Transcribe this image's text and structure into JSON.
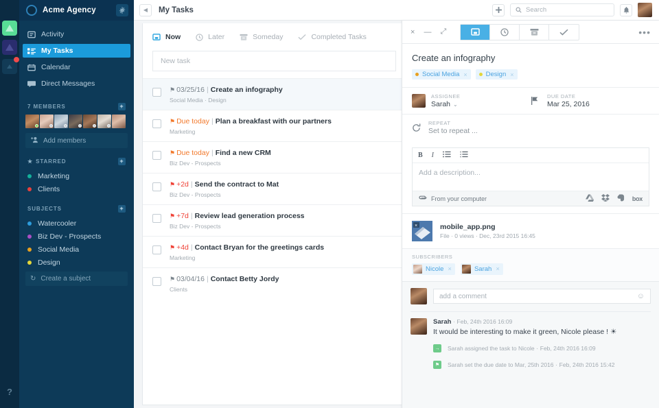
{
  "colors": {
    "sidebar_bg": "#0d3a58",
    "rail_bg": "#0b2b42",
    "accent_blue": "#1b9bdb",
    "tab_active": "#49b0e5",
    "orange": "#f2792c",
    "red": "#ef4136",
    "green": "#6ecb8a"
  },
  "rail": {
    "tiles": [
      {
        "name": "workspace-green",
        "icon": "triangle-icon",
        "badge": false
      },
      {
        "name": "workspace-purple",
        "icon": "triangle-icon",
        "badge": false
      },
      {
        "name": "workspace-muted",
        "icon": "triangle-icon",
        "badge": true
      }
    ],
    "help_label": "?"
  },
  "sidebar": {
    "logo_icon": "circle-logo-icon",
    "workspace_title": "Acme Agency",
    "gear_icon": "gear-icon",
    "nav": [
      {
        "label": "Activity",
        "icon": "activity-icon",
        "active": false
      },
      {
        "label": "My Tasks",
        "icon": "tasks-icon",
        "active": true
      },
      {
        "label": "Calendar",
        "icon": "calendar-icon",
        "active": false
      },
      {
        "label": "Direct Messages",
        "icon": "messages-icon",
        "active": false
      }
    ],
    "members_section": {
      "title": "7 MEMBERS",
      "add_icon": "plus-icon",
      "count": 7,
      "avatars": [
        {
          "name": "member-1",
          "status": "#7ed957"
        },
        {
          "name": "member-2",
          "status": "#c8d0d6"
        },
        {
          "name": "member-3",
          "status": "#c8d0d6"
        },
        {
          "name": "member-4",
          "status": "#c8d0d6"
        },
        {
          "name": "member-5",
          "status": "#c8d0d6"
        },
        {
          "name": "member-6",
          "status": "#c8d0d6"
        },
        {
          "name": "member-7",
          "status": "#c8d0d6"
        }
      ],
      "add_members_label": "Add members",
      "add_members_icon": "add-person-icon"
    },
    "starred_section": {
      "title": "STARRED",
      "star_icon": "star-icon",
      "add_icon": "plus-icon",
      "items": [
        {
          "label": "Marketing",
          "color": "#13b09a"
        },
        {
          "label": "Clients",
          "color": "#e8413c"
        }
      ]
    },
    "subjects_section": {
      "title": "SUBJECTS",
      "add_icon": "plus-icon",
      "items": [
        {
          "label": "Watercooler",
          "color": "#2d9cdb"
        },
        {
          "label": "Biz Dev - Prospects",
          "color": "#a94fc4"
        },
        {
          "label": "Social Media",
          "color": "#e8a020"
        },
        {
          "label": "Design",
          "color": "#e3d63a"
        }
      ],
      "create_label": "Create a subject",
      "create_icon": "refresh-icon"
    }
  },
  "topbar": {
    "collapse_icon": "chevron-left-icon",
    "page_title": "My Tasks",
    "add_icon": "plus-icon",
    "search_icon": "search-icon",
    "search_placeholder": "Search",
    "search_value": "",
    "bell_icon": "bell-icon",
    "avatar_name": "user-avatar"
  },
  "tasklist": {
    "tabs": [
      {
        "label": "Now",
        "icon": "inbox-icon",
        "active": true
      },
      {
        "label": "Later",
        "icon": "clock-icon",
        "active": false
      },
      {
        "label": "Someday",
        "icon": "archive-icon",
        "active": false
      },
      {
        "label": "Completed Tasks",
        "icon": "check-icon",
        "active": false
      }
    ],
    "new_task_placeholder": "New task",
    "new_task_value": "",
    "tasks": [
      {
        "due": "03/25/16",
        "due_style": "gray",
        "name": "Create an infography",
        "subjects": "Social Media · Design",
        "selected": true,
        "checked": false
      },
      {
        "due": "Due today",
        "due_style": "orange",
        "name": "Plan a breakfast with our partners",
        "subjects": "Marketing",
        "selected": false,
        "checked": false
      },
      {
        "due": "Due today",
        "due_style": "orange",
        "name": "Find a new CRM",
        "subjects": "Biz Dev - Prospects",
        "selected": false,
        "checked": false
      },
      {
        "due": "+2d",
        "due_style": "red",
        "name": "Send the contract to Mat",
        "subjects": "Biz Dev - Prospects",
        "selected": false,
        "checked": false
      },
      {
        "due": "+7d",
        "due_style": "red",
        "name": "Review lead generation process",
        "subjects": "Biz Dev - Prospects",
        "selected": false,
        "checked": false
      },
      {
        "due": "+4d",
        "due_style": "red",
        "name": "Contact Bryan for the greetings cards",
        "subjects": "Marketing",
        "selected": false,
        "checked": false
      },
      {
        "due": "03/04/16",
        "due_style": "gray",
        "name": "Contact Betty Jordy",
        "subjects": "Clients",
        "selected": false,
        "checked": false
      }
    ]
  },
  "detail": {
    "window_controls": {
      "close": "×",
      "minimize": "—",
      "expand": "⤢"
    },
    "tabs": [
      {
        "name": "comments-tab",
        "icon": "comment-icon",
        "active": true
      },
      {
        "name": "later-tab",
        "icon": "clock-icon",
        "active": false
      },
      {
        "name": "archive-tab",
        "icon": "archive-icon",
        "active": false
      },
      {
        "name": "complete-tab",
        "icon": "check-icon",
        "active": false
      }
    ],
    "more_icon": "ellipsis-icon",
    "title": "Create an infography",
    "tags": [
      {
        "label": "Social Media",
        "color": "#e8a020",
        "remove": "×"
      },
      {
        "label": "Design",
        "color": "#e3d63a",
        "remove": "×"
      }
    ],
    "assignee": {
      "label": "ASSIGNEE",
      "value": "Sarah",
      "caret": "⌄",
      "avatar": "assignee-avatar"
    },
    "due_date": {
      "label": "DUE DATE",
      "value": "Mar 25, 2016",
      "icon": "flag-icon"
    },
    "repeat": {
      "label": "REPEAT",
      "value": "Set to repeat ...",
      "icon": "repeat-icon"
    },
    "editor": {
      "tools": [
        {
          "name": "bold-icon",
          "glyph": "B"
        },
        {
          "name": "italic-icon",
          "glyph": "I"
        },
        {
          "name": "bullet-list-icon",
          "glyph": "☰"
        },
        {
          "name": "numbered-list-icon",
          "glyph": "☲"
        }
      ],
      "placeholder": "Add a description...",
      "value": "",
      "upload_label": "From your computer",
      "clip_icon": "paperclip-icon",
      "services": [
        {
          "name": "google-drive-icon",
          "label": "Drive"
        },
        {
          "name": "dropbox-icon",
          "label": "Dropbox"
        },
        {
          "name": "evernote-icon",
          "label": "Evernote"
        },
        {
          "name": "box-icon",
          "label": "box"
        }
      ]
    },
    "attachment": {
      "thumb_name": "image-thumbnail",
      "filename": "mobile_app.png",
      "meta": "File · 0 views · Dec, 23rd 2015 16:45"
    },
    "subscribers": {
      "label": "SUBSCRIBERS",
      "items": [
        {
          "name": "Nicole",
          "remove": "×"
        },
        {
          "name": "Sarah",
          "remove": "×"
        }
      ]
    },
    "comment_box": {
      "placeholder": "add a comment",
      "value": "",
      "avatar": "current-user-avatar",
      "emoji_icon": "smiley-icon"
    },
    "comments": [
      {
        "author": "Sarah",
        "timestamp": "Feb, 24th 2016 16:09",
        "separator": "·",
        "text": "It would be interesting to make it green, Nicole please ! ☀"
      }
    ],
    "events": [
      {
        "icon": "assign-icon",
        "text": "Sarah assigned the task to Nicole",
        "separator": "·",
        "timestamp": "Feb, 24th 2016 16:09"
      },
      {
        "icon": "flag-icon",
        "text": "Sarah set the due date to Mar, 25th 2016",
        "separator": "·",
        "timestamp": "Feb, 24th 2016 15:42"
      }
    ]
  }
}
